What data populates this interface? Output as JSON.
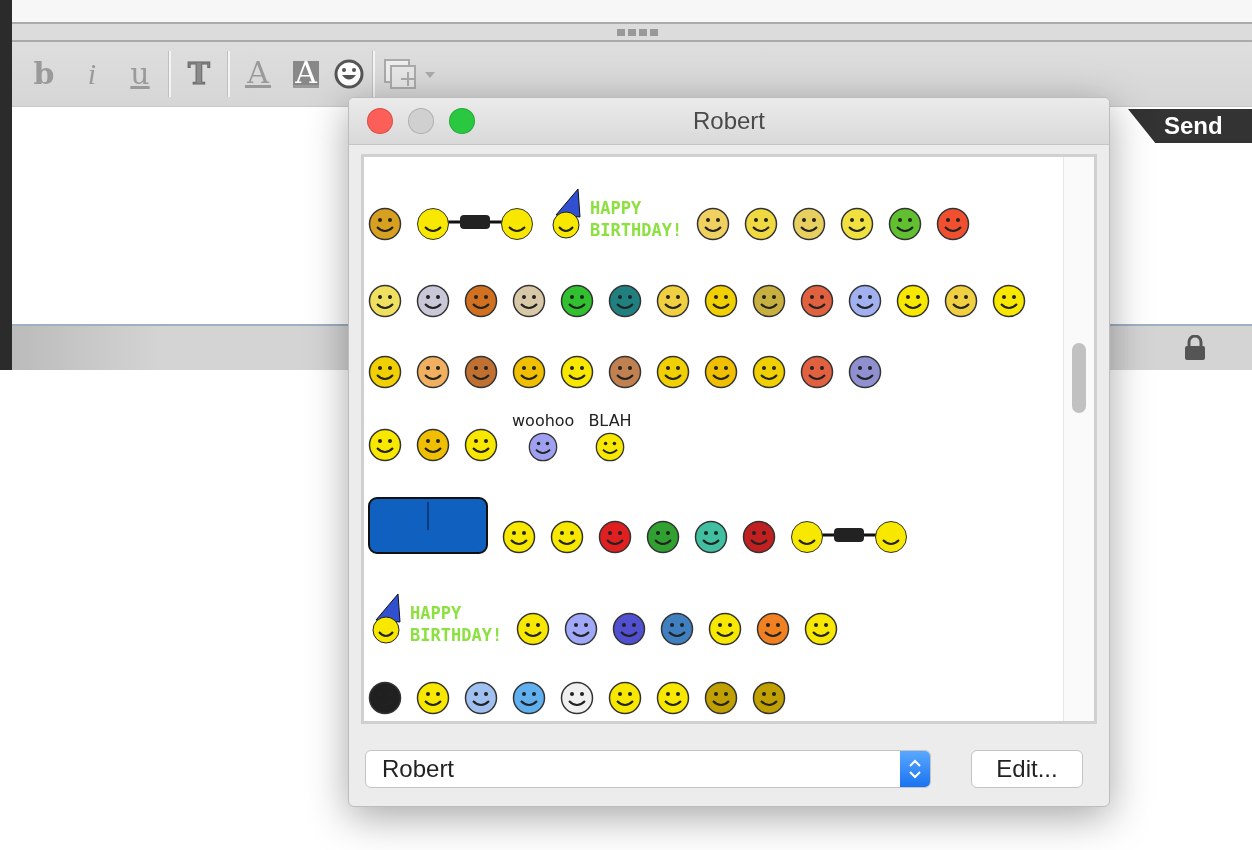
{
  "toolbar": [
    {
      "kind": "bold",
      "label": "b"
    },
    {
      "kind": "italic",
      "label": "i"
    },
    {
      "kind": "underline",
      "label": "u"
    },
    {
      "kind": "separator"
    },
    {
      "kind": "outline",
      "label": "T"
    },
    {
      "kind": "separator"
    },
    {
      "kind": "text-color",
      "label": "A"
    },
    {
      "kind": "back-color",
      "label": "A"
    },
    {
      "kind": "smiley"
    },
    {
      "kind": "separator"
    },
    {
      "kind": "insert"
    }
  ],
  "send_button": "Send",
  "dialog": {
    "title": "Robert",
    "rows": [
      [
        {
          "kind": "face",
          "color": "#d8a020"
        },
        {
          "kind": "linked",
          "color": "#f8e800"
        },
        {
          "kind": "banner",
          "lines": [
            "HAPPY",
            "BIRTHDAY!"
          ]
        },
        {
          "kind": "face",
          "color": "#f0d060"
        },
        {
          "kind": "face",
          "color": "#f0d840"
        },
        {
          "kind": "face",
          "color": "#e8d060"
        },
        {
          "kind": "face",
          "color": "#f0e040"
        },
        {
          "kind": "face",
          "color": "#60c030"
        },
        {
          "kind": "face",
          "color": "#f05030"
        }
      ],
      [
        {
          "kind": "face",
          "color": "#f0e060"
        },
        {
          "kind": "face",
          "color": "#c8c8d8"
        },
        {
          "kind": "face",
          "color": "#d07020"
        },
        {
          "kind": "face",
          "color": "#d8c8a8"
        },
        {
          "kind": "face",
          "color": "#30c030"
        },
        {
          "kind": "face",
          "color": "#208080"
        },
        {
          "kind": "face",
          "color": "#f0d040"
        },
        {
          "kind": "face",
          "color": "#f0d000"
        },
        {
          "kind": "face",
          "color": "#c8b040"
        },
        {
          "kind": "face",
          "color": "#e06040"
        },
        {
          "kind": "face",
          "color": "#a0b0f0"
        },
        {
          "kind": "face",
          "color": "#f8e800"
        },
        {
          "kind": "face",
          "color": "#f0d040"
        },
        {
          "kind": "face",
          "color": "#f8e800"
        }
      ],
      [
        {
          "kind": "face",
          "color": "#f0d000"
        },
        {
          "kind": "face",
          "color": "#f0b060"
        },
        {
          "kind": "face",
          "color": "#c07030"
        },
        {
          "kind": "face",
          "color": "#f0c000"
        },
        {
          "kind": "face",
          "color": "#f8e800"
        },
        {
          "kind": "face",
          "color": "#c08050"
        },
        {
          "kind": "face",
          "color": "#f0d000"
        },
        {
          "kind": "face",
          "color": "#f0c000"
        },
        {
          "kind": "face",
          "color": "#f0d000"
        },
        {
          "kind": "face",
          "color": "#e06040"
        },
        {
          "kind": "face",
          "color": "#9090d0"
        }
      ],
      [
        {
          "kind": "face",
          "color": "#f8e800"
        },
        {
          "kind": "face",
          "color": "#f0c000"
        },
        {
          "kind": "face",
          "color": "#f8e800"
        },
        {
          "kind": "caption",
          "text": "woohoo",
          "color": "#a0a0f0"
        },
        {
          "kind": "caption",
          "text": "BLAH",
          "color": "#f8e800"
        }
      ],
      [
        {
          "kind": "sofa",
          "color": "#1060c0"
        },
        {
          "kind": "face",
          "color": "#f8e800"
        },
        {
          "kind": "face",
          "color": "#f8e800"
        },
        {
          "kind": "face",
          "color": "#e02020"
        },
        {
          "kind": "face",
          "color": "#30a030"
        },
        {
          "kind": "face",
          "color": "#40c0a0"
        },
        {
          "kind": "face",
          "color": "#c02020"
        },
        {
          "kind": "linked",
          "color": "#f8e800"
        }
      ],
      [
        {
          "kind": "banner",
          "lines": [
            "HAPPY",
            "BIRTHDAY!"
          ]
        },
        {
          "kind": "face",
          "color": "#f8e800"
        },
        {
          "kind": "face",
          "color": "#a0a8f8"
        },
        {
          "kind": "face",
          "color": "#5050d0"
        },
        {
          "kind": "face",
          "color": "#4080c0"
        },
        {
          "kind": "face",
          "color": "#f8e800"
        },
        {
          "kind": "face",
          "color": "#f08020"
        },
        {
          "kind": "face",
          "color": "#f8e800"
        }
      ],
      [
        {
          "kind": "face",
          "color": "#202020"
        },
        {
          "kind": "face",
          "color": "#f8e800"
        },
        {
          "kind": "face",
          "color": "#a0c0f0"
        },
        {
          "kind": "face",
          "color": "#60b0f0"
        },
        {
          "kind": "face",
          "color": "#f0f0f0"
        },
        {
          "kind": "face",
          "color": "#f8e800"
        },
        {
          "kind": "face",
          "color": "#f8e800"
        },
        {
          "kind": "face",
          "color": "#c0a000"
        },
        {
          "kind": "face",
          "color": "#c0a000"
        }
      ]
    ],
    "set_select": {
      "value": "Robert"
    },
    "edit_button": "Edit..."
  }
}
